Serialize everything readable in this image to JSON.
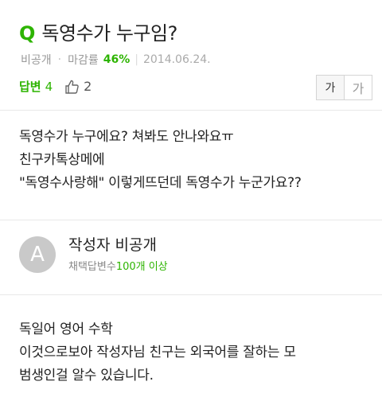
{
  "question": {
    "icon": "Q",
    "title": "독영수가 누구임?",
    "author": "비공개",
    "rate_label": "마감률",
    "rate_value": "46%",
    "date": "2014.06.24.",
    "answers_label": "답변",
    "answers_count": "4",
    "like_count": "2",
    "font_size_small": "가",
    "font_size_large": "가",
    "body_lines": [
      "독영수가 누구에요? 쳐봐도 안나와요ㅠ",
      "친구카톡상메에",
      "\"독영수사랑해\" 이렇게뜨던데 독영수가 누군가요??"
    ]
  },
  "answer": {
    "avatar_letter": "A",
    "author_name": "작성자 비공개",
    "stat_prefix": "채택답변수",
    "stat_value": "100개 이상",
    "body_lines": [
      "독일어 영어 수학",
      "이것으로보아 작성자님 친구는 외국어를 잘하는 모",
      "범생인걸 알수 있습니다."
    ]
  },
  "colors": {
    "accent": "#2db400",
    "muted": "#999999",
    "avatar_bg": "#c9c9c9"
  }
}
